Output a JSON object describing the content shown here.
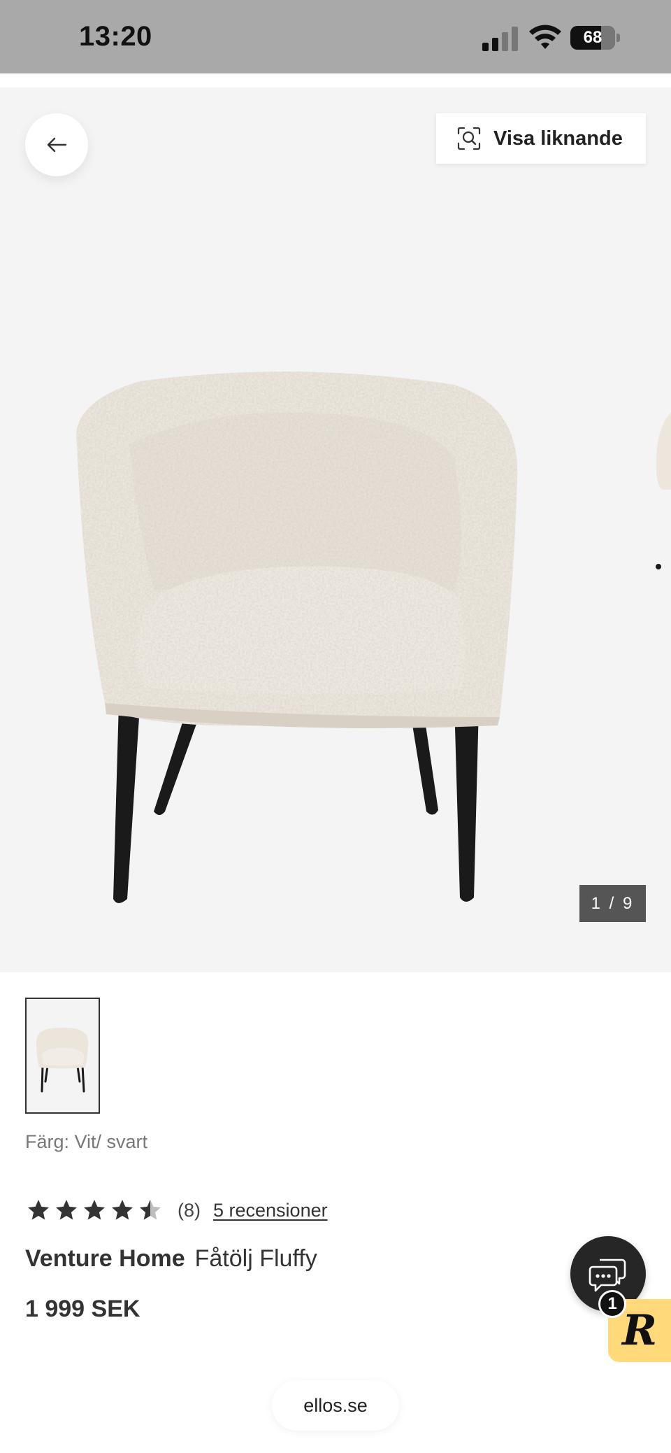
{
  "status_bar": {
    "time": "13:20",
    "battery_percent": "68",
    "battery_level": 0.68,
    "signal_bars_active": 2,
    "signal_bars_total": 4
  },
  "gallery": {
    "similar_button_label": "Visa liknande",
    "counter": "1 / 9"
  },
  "product": {
    "color": "Färg: Vit/ svart",
    "rating": {
      "value": 4.5,
      "max": 5,
      "count": "(8)",
      "reviews_link": "5 recensioner"
    },
    "brand": "Venture Home",
    "name": "Fåtölj Fluffy",
    "price": "1 999 SEK"
  },
  "chat": {
    "badge_count": "1",
    "r_badge_letter": "R"
  },
  "browser": {
    "domain": "ellos.se"
  },
  "colors": {
    "status_bar_bg": "#a9a9a9",
    "gallery_bg": "#f4f4f4",
    "counter_bg": "#555555",
    "chat_bg": "#262626",
    "r_badge_bg": "#ffd97a"
  },
  "icons": {
    "back": "arrow-left-icon",
    "similar": "visual-search-icon",
    "chat": "chat-bubble-icon"
  }
}
